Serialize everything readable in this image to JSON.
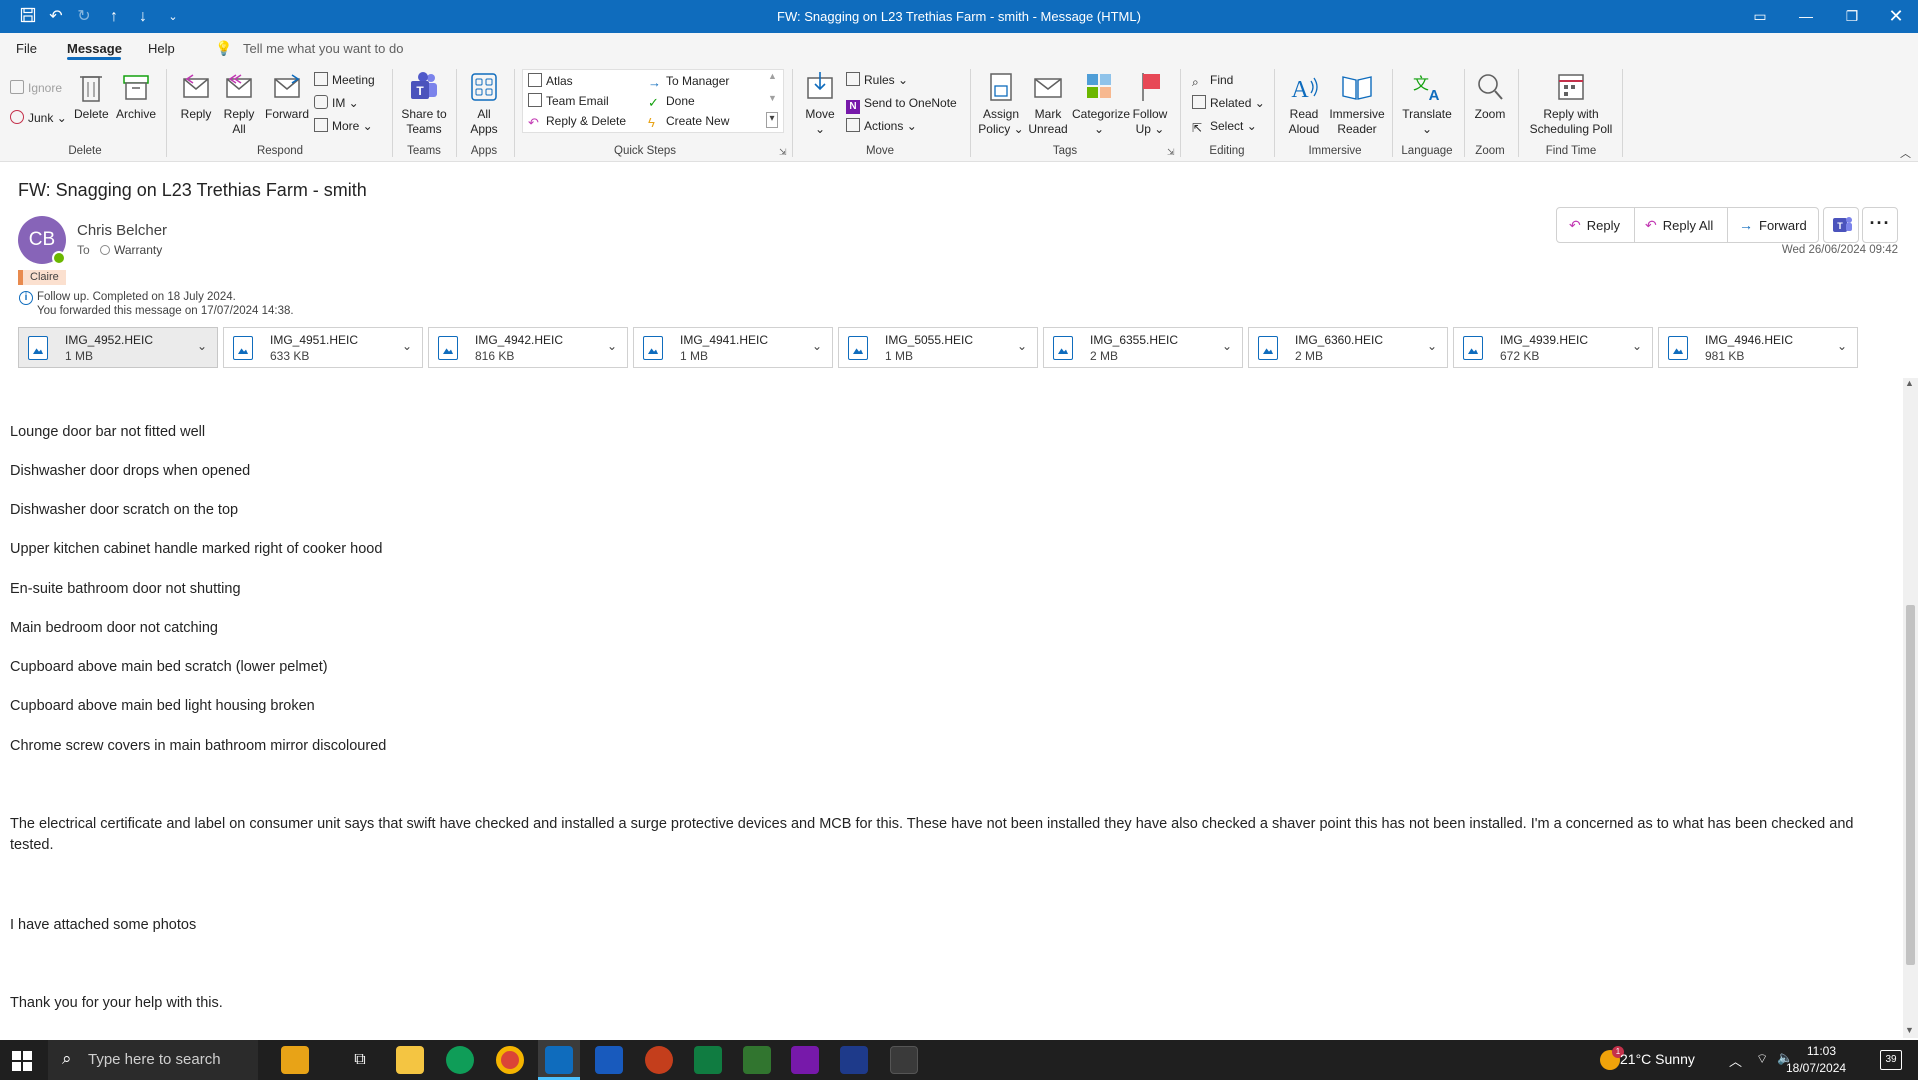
{
  "window": {
    "title": "FW: Snagging on L23 Trethias Farm - smith  -  Message (HTML)"
  },
  "menu": {
    "tabs": [
      "File",
      "Message",
      "Help"
    ],
    "tell_me": "Tell me what you want to do"
  },
  "ribbon": {
    "delete_group": {
      "label": "Delete",
      "ignore": "Ignore",
      "junk": "Junk",
      "delete": "Delete",
      "archive": "Archive"
    },
    "respond_group": {
      "label": "Respond",
      "reply": "Reply",
      "reply_all_1": "Reply",
      "reply_all_2": "All",
      "forward": "Forward",
      "meeting": "Meeting",
      "im": "IM",
      "more": "More"
    },
    "teams_group": {
      "label": "Teams",
      "share_1": "Share to",
      "share_2": "Teams"
    },
    "apps_group": {
      "label": "Apps",
      "all_apps_1": "All",
      "all_apps_2": "Apps"
    },
    "quick_steps_group": {
      "label": "Quick Steps",
      "items": [
        "Atlas",
        "Team Email",
        "Reply & Delete",
        "To Manager",
        "Done",
        "Create New"
      ]
    },
    "move_group": {
      "label": "Move",
      "move": "Move",
      "rules": "Rules",
      "send_onenote": "Send to OneNote",
      "actions": "Actions"
    },
    "tags_group": {
      "label": "Tags",
      "assign_1": "Assign",
      "assign_2": "Policy",
      "mark_1": "Mark",
      "mark_2": "Unread",
      "categorize": "Categorize",
      "follow_1": "Follow",
      "follow_2": "Up"
    },
    "editing_group": {
      "label": "Editing",
      "find": "Find",
      "related": "Related",
      "select": "Select"
    },
    "immersive_group": {
      "label": "Immersive",
      "read_1": "Read",
      "read_2": "Aloud",
      "imm_1": "Immersive",
      "imm_2": "Reader"
    },
    "language_group": {
      "label": "Language",
      "translate": "Translate"
    },
    "zoom_group": {
      "label": "Zoom",
      "zoom": "Zoom"
    },
    "findtime_group": {
      "label": "Find Time",
      "poll_1": "Reply with",
      "poll_2": "Scheduling Poll"
    }
  },
  "message": {
    "subject": "FW: Snagging on L23 Trethias Farm - smith",
    "avatar_initials": "CB",
    "sender": "Chris Belcher",
    "to_label": "To",
    "to_name": "Warranty",
    "category": "Claire",
    "followup": "Follow up.  Completed on 18 July 2024.",
    "forwarded": "You forwarded this message on 17/07/2024 14:38.",
    "date": "Wed 26/06/2024 09:42",
    "actions": {
      "reply": "Reply",
      "reply_all": "Reply All",
      "forward": "Forward"
    }
  },
  "attachments": [
    {
      "name": "IMG_4952.HEIC",
      "size": "1 MB"
    },
    {
      "name": "IMG_4951.HEIC",
      "size": "633 KB"
    },
    {
      "name": "IMG_4942.HEIC",
      "size": "816 KB"
    },
    {
      "name": "IMG_4941.HEIC",
      "size": "1 MB"
    },
    {
      "name": "IMG_5055.HEIC",
      "size": "1 MB"
    },
    {
      "name": "IMG_6355.HEIC",
      "size": "2 MB"
    },
    {
      "name": "IMG_6360.HEIC",
      "size": "2 MB"
    },
    {
      "name": "IMG_4939.HEIC",
      "size": "672 KB"
    },
    {
      "name": "IMG_4946.HEIC",
      "size": "981 KB"
    }
  ],
  "body": {
    "lines": [
      "Lounge door bar not fitted well",
      "Dishwasher door drops when opened",
      "Dishwasher door scratch on the top",
      "Upper kitchen cabinet handle marked right of cooker hood",
      "En-suite bathroom door not shutting",
      "Main bedroom door not catching",
      "Cupboard above main bed scratch (lower pelmet)",
      "Cupboard above main bed light housing broken",
      "Chrome screw covers in main bathroom mirror discoloured"
    ],
    "paragraph": "The electrical certificate and label on consumer unit says that swift have checked and installed a surge protective devices and MCB for this. These have not been installed they have also checked a shaver point this has not been installed. I'm a concerned as to what has been checked and tested.",
    "attached_line": "I have attached some photos",
    "thanks": "Thank you for your help with this."
  },
  "taskbar": {
    "search_placeholder": "Type here to search",
    "weather": "21°C  Sunny",
    "weather_badge": "1",
    "time": "11:03",
    "date": "18/07/2024",
    "notifications": "39"
  },
  "colors": {
    "accent": "#0f6cbd",
    "avatar": "#8764b8",
    "presence": "#6bb700"
  }
}
